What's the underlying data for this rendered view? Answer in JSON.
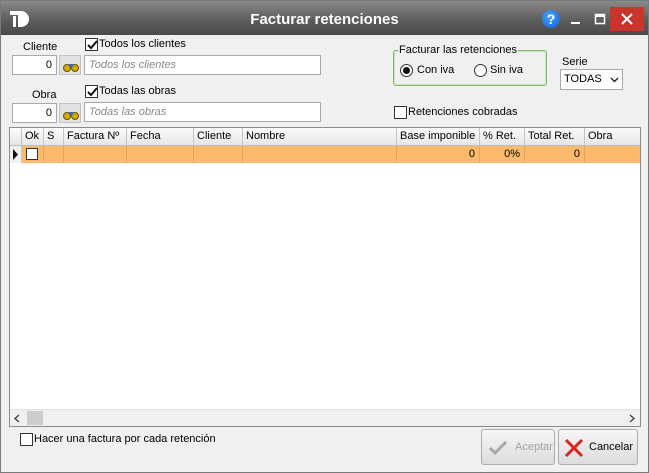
{
  "window": {
    "title": "Facturar retenciones"
  },
  "cliente": {
    "label": "Cliente",
    "value": "0",
    "all_label": "Todos los clientes",
    "placeholder": "Todos los clientes"
  },
  "obra": {
    "label": "Obra",
    "value": "0",
    "all_label": "Todas las obras",
    "placeholder": "Todas las obras"
  },
  "facturar_group": {
    "title": "Facturar las retenciones",
    "option_con": "Con iva",
    "option_sin": "Sin iva",
    "selected": "Con iva"
  },
  "serie": {
    "label": "Serie",
    "value": "TODAS"
  },
  "retenciones_cobradas": {
    "label": "Retenciones cobradas",
    "checked": false
  },
  "grid": {
    "columns": [
      "Ok",
      "S",
      "Factura Nº",
      "Fecha",
      "Cliente",
      "Nombre",
      "Base imponible",
      "% Ret.",
      "Total Ret.",
      "Obra"
    ],
    "rows": [
      {
        "ok": false,
        "s": "",
        "factura": "",
        "fecha": "",
        "cliente": "",
        "nombre": "",
        "base": "0",
        "ret": "0%",
        "total": "0",
        "obra": ""
      }
    ]
  },
  "footer": {
    "factura_por_retencion": "Hacer una factura por cada retención",
    "aceptar_label": "Aceptar",
    "cancelar_label": "Cancelar"
  },
  "colors": {
    "titlebar": "#5d5d5d",
    "row_highlight": "#fcbb6c",
    "close": "#c9352b",
    "group_border": "#7fb86d"
  }
}
